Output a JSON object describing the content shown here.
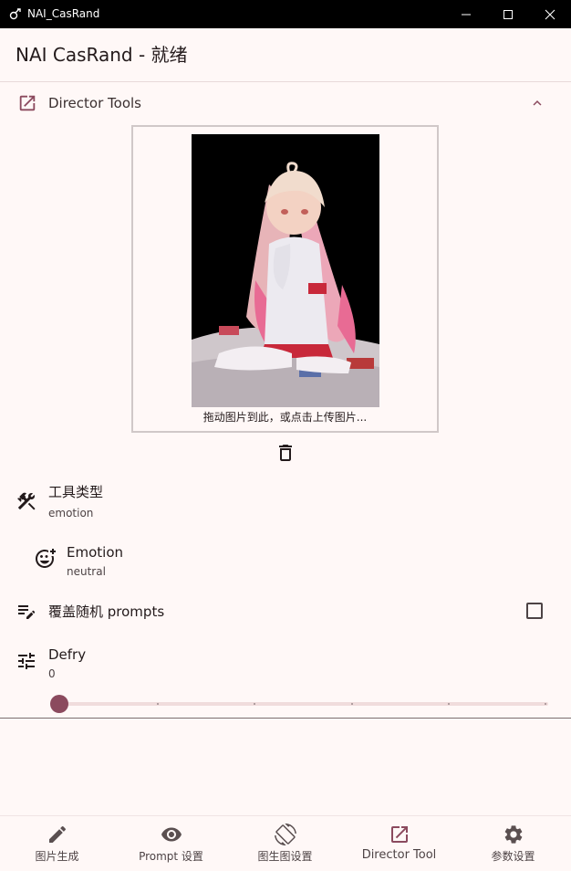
{
  "window": {
    "title": "NAI_CasRand"
  },
  "appbar": {
    "title": "NAI CasRand - 就绪"
  },
  "director": {
    "section_label": "Director Tools",
    "drop_hint": "拖动图片到此，或点击上传图片..."
  },
  "settings": {
    "tool_type": {
      "label": "工具类型",
      "value": "emotion"
    },
    "emotion": {
      "label": "Emotion",
      "value": "neutral"
    },
    "override_random": {
      "label": "覆盖随机 prompts",
      "checked": false
    },
    "defry": {
      "label": "Defry",
      "value": "0",
      "slider_fraction": 0
    }
  },
  "nav": {
    "items": [
      {
        "label": "图片生成",
        "icon": "pencil-icon"
      },
      {
        "label": "Prompt 设置",
        "icon": "eye-icon"
      },
      {
        "label": "图生图设置",
        "icon": "rotate-icon"
      },
      {
        "label": "Director Tool",
        "icon": "open-in-new-icon"
      },
      {
        "label": "参数设置",
        "icon": "gear-icon"
      }
    ],
    "active_index": 3
  },
  "colors": {
    "accent": "#8b4a5e",
    "background": "#fff8f7"
  }
}
